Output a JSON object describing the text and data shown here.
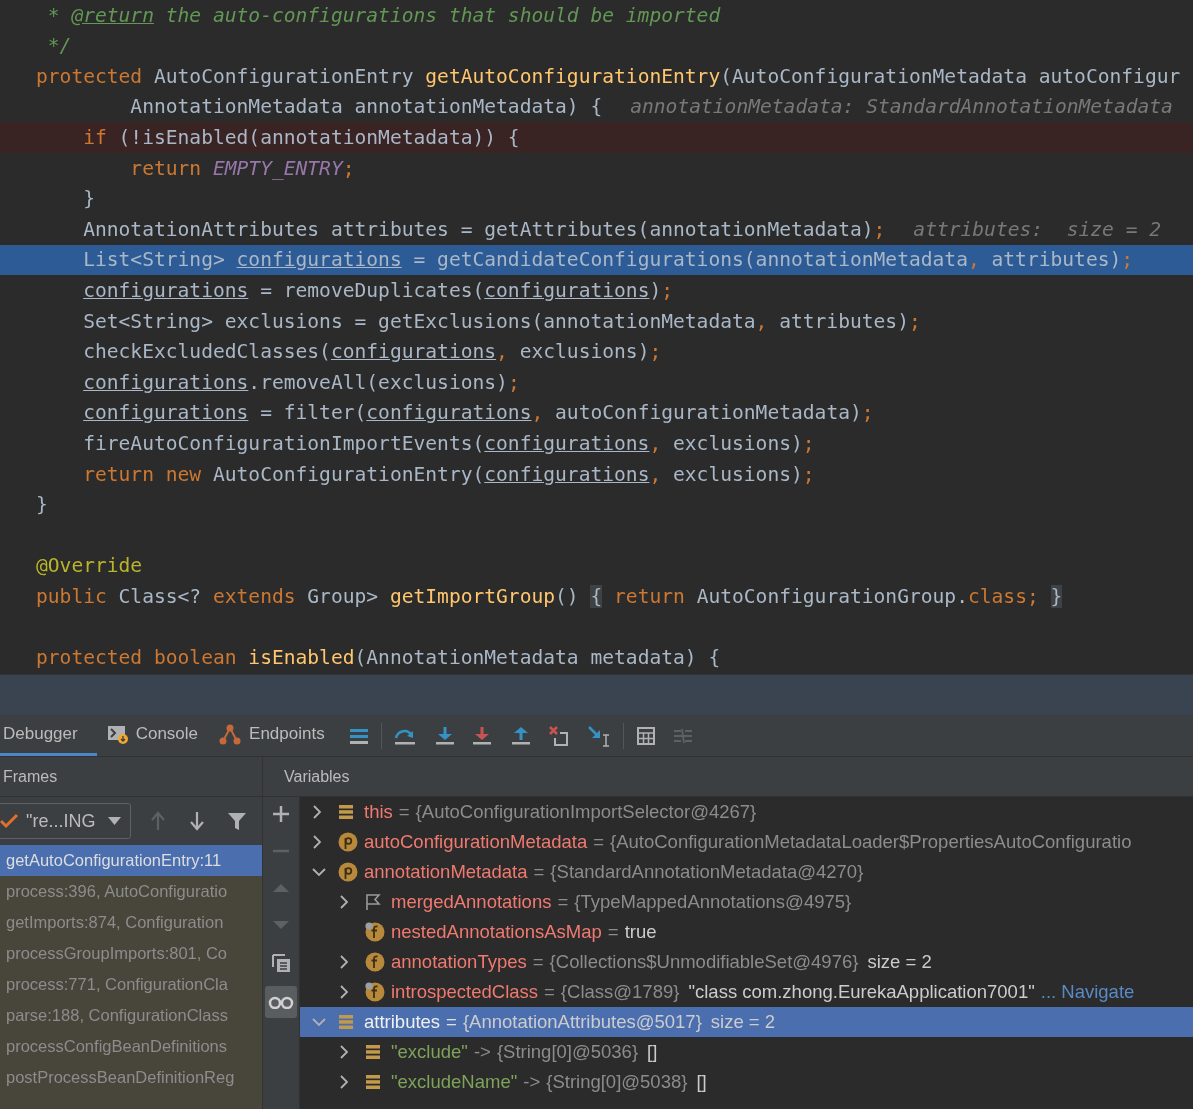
{
  "editor": {
    "lines": [
      {
        "breakpoint": false,
        "execution_point": false,
        "tokens": [
          {
            "text": " * ",
            "kind": "comment"
          },
          {
            "text": "@return",
            "kind": "doctag"
          },
          {
            "text": " the auto-configurations that should be imported",
            "kind": "comment"
          }
        ]
      },
      {
        "breakpoint": false,
        "execution_point": false,
        "tokens": [
          {
            "text": " */",
            "kind": "comment"
          }
        ]
      },
      {
        "breakpoint": false,
        "execution_point": false,
        "tokens": [
          {
            "text": "protected ",
            "kind": "keyword"
          },
          {
            "text": "AutoConfigurationEntry ",
            "kind": "plain"
          },
          {
            "text": "getAutoConfigurationEntry",
            "kind": "declaration"
          },
          {
            "text": "(AutoConfigurationMetadata autoConfigur",
            "kind": "plain"
          }
        ]
      },
      {
        "breakpoint": false,
        "execution_point": false,
        "tokens": [
          {
            "text": "        AnnotationMetadata annotationMetadata) {",
            "kind": "plain"
          }
        ],
        "hint": "annotationMetadata: StandardAnnotationMetadata"
      },
      {
        "breakpoint": true,
        "execution_point": false,
        "tokens": [
          {
            "text": "    if ",
            "kind": "keyword"
          },
          {
            "text": "(!isEnabled(annotationMetadata)) {",
            "kind": "plain"
          }
        ]
      },
      {
        "breakpoint": false,
        "execution_point": false,
        "tokens": [
          {
            "text": "        return ",
            "kind": "keyword"
          },
          {
            "text": "EMPTY_ENTRY",
            "kind": "constant"
          },
          {
            "text": ";",
            "kind": "keyword"
          }
        ]
      },
      {
        "breakpoint": false,
        "execution_point": false,
        "tokens": [
          {
            "text": "    }",
            "kind": "plain"
          }
        ]
      },
      {
        "breakpoint": false,
        "execution_point": false,
        "tokens": [
          {
            "text": "    AnnotationAttributes attributes = getAttributes(annotationMetadata)",
            "kind": "plain"
          },
          {
            "text": ";",
            "kind": "keyword"
          }
        ],
        "hint": "attributes:  size = 2"
      },
      {
        "breakpoint": false,
        "execution_point": true,
        "tokens": [
          {
            "text": "    List<String> ",
            "kind": "plain"
          },
          {
            "text": "configurations",
            "kind": "reassigned"
          },
          {
            "text": " = getCandidateConfigurations(annotationMetadata",
            "kind": "plain"
          },
          {
            "text": ",",
            "kind": "keyword"
          },
          {
            "text": " attributes)",
            "kind": "plain"
          },
          {
            "text": ";",
            "kind": "keyword"
          }
        ]
      },
      {
        "breakpoint": false,
        "execution_point": false,
        "tokens": [
          {
            "text": "    configurations",
            "kind": "reassigned"
          },
          {
            "text": " = removeDuplicates(",
            "kind": "plain"
          },
          {
            "text": "configurations",
            "kind": "reassigned"
          },
          {
            "text": ")",
            "kind": "plain"
          },
          {
            "text": ";",
            "kind": "keyword"
          }
        ]
      },
      {
        "breakpoint": false,
        "execution_point": false,
        "tokens": [
          {
            "text": "    Set<String> exclusions = getExclusions(annotationMetadata",
            "kind": "plain"
          },
          {
            "text": ",",
            "kind": "keyword"
          },
          {
            "text": " attributes)",
            "kind": "plain"
          },
          {
            "text": ";",
            "kind": "keyword"
          }
        ]
      },
      {
        "breakpoint": false,
        "execution_point": false,
        "tokens": [
          {
            "text": "    checkExcludedClasses(",
            "kind": "plain"
          },
          {
            "text": "configurations",
            "kind": "reassigned"
          },
          {
            "text": ",",
            "kind": "keyword"
          },
          {
            "text": " exclusions)",
            "kind": "plain"
          },
          {
            "text": ";",
            "kind": "keyword"
          }
        ]
      },
      {
        "breakpoint": false,
        "execution_point": false,
        "tokens": [
          {
            "text": "    configurations",
            "kind": "reassigned"
          },
          {
            "text": ".removeAll(exclusions)",
            "kind": "plain"
          },
          {
            "text": ";",
            "kind": "keyword"
          }
        ]
      },
      {
        "breakpoint": false,
        "execution_point": false,
        "tokens": [
          {
            "text": "    configurations",
            "kind": "reassigned"
          },
          {
            "text": " = filter(",
            "kind": "plain"
          },
          {
            "text": "configurations",
            "kind": "reassigned"
          },
          {
            "text": ",",
            "kind": "keyword"
          },
          {
            "text": " autoConfigurationMetadata)",
            "kind": "plain"
          },
          {
            "text": ";",
            "kind": "keyword"
          }
        ]
      },
      {
        "breakpoint": false,
        "execution_point": false,
        "tokens": [
          {
            "text": "    fireAutoConfigurationImportEvents(",
            "kind": "plain"
          },
          {
            "text": "configurations",
            "kind": "reassigned"
          },
          {
            "text": ",",
            "kind": "keyword"
          },
          {
            "text": " exclusions)",
            "kind": "plain"
          },
          {
            "text": ";",
            "kind": "keyword"
          }
        ]
      },
      {
        "breakpoint": false,
        "execution_point": false,
        "tokens": [
          {
            "text": "    return new ",
            "kind": "keyword"
          },
          {
            "text": "AutoConfigurationEntry(",
            "kind": "plain"
          },
          {
            "text": "configurations",
            "kind": "reassigned"
          },
          {
            "text": ",",
            "kind": "keyword"
          },
          {
            "text": " exclusions)",
            "kind": "plain"
          },
          {
            "text": ";",
            "kind": "keyword"
          }
        ]
      },
      {
        "breakpoint": false,
        "execution_point": false,
        "tokens": [
          {
            "text": "}",
            "kind": "plain"
          }
        ]
      },
      {
        "breakpoint": false,
        "execution_point": false
      },
      {
        "breakpoint": false,
        "execution_point": false,
        "tokens": [
          {
            "text": "@Override",
            "kind": "annotation"
          }
        ]
      },
      {
        "breakpoint": false,
        "execution_point": false,
        "tokens": [
          {
            "text": "public ",
            "kind": "keyword"
          },
          {
            "text": "Class<? ",
            "kind": "plain"
          },
          {
            "text": "extends ",
            "kind": "keyword"
          },
          {
            "text": "Group> ",
            "kind": "plain"
          },
          {
            "text": "getImportGroup",
            "kind": "declaration"
          },
          {
            "text": "() ",
            "kind": "plain"
          },
          {
            "text": "{",
            "kind": "fold"
          },
          {
            "text": " return ",
            "kind": "keyword"
          },
          {
            "text": "AutoConfigurationGroup.",
            "kind": "plain"
          },
          {
            "text": "class; ",
            "kind": "keyword"
          },
          {
            "text": "}",
            "kind": "fold"
          }
        ]
      },
      {
        "breakpoint": false,
        "execution_point": false
      },
      {
        "breakpoint": false,
        "execution_point": false,
        "tokens": [
          {
            "text": "protected boolean ",
            "kind": "keyword"
          },
          {
            "text": "isEnabled",
            "kind": "declaration"
          },
          {
            "text": "(AnnotationMetadata metadata) {",
            "kind": "plain"
          }
        ]
      }
    ]
  },
  "debugger": {
    "tabs": [
      {
        "label": "Debugger",
        "selected": true,
        "kind": "debugger"
      },
      {
        "label": "Console",
        "selected": false,
        "kind": "console"
      },
      {
        "label": "Endpoints",
        "selected": false,
        "kind": "endpoints"
      }
    ],
    "frames": {
      "title": "Frames",
      "thread": "\"re...ING",
      "items": [
        {
          "label": "getAutoConfigurationEntry:11",
          "selected": true
        },
        {
          "label": "process:396, AutoConfiguratio",
          "selected": false
        },
        {
          "label": "getImports:874, Configuration",
          "selected": false
        },
        {
          "label": "processGroupImports:801, Co",
          "selected": false
        },
        {
          "label": "process:771, ConfigurationCla",
          "selected": false
        },
        {
          "label": "parse:188, ConfigurationClass",
          "selected": false
        },
        {
          "label": "processConfigBeanDefinitions",
          "selected": false
        },
        {
          "label": "postProcessBeanDefinitionReg",
          "selected": false
        }
      ]
    },
    "variables": {
      "title": "Variables",
      "nodes": [
        {
          "name": "this",
          "kind": "object",
          "expandable": true,
          "expanded": false,
          "selected": false,
          "separator": "=",
          "value": "{AutoConfigurationImportSelector@4267}"
        },
        {
          "name": "autoConfigurationMetadata",
          "kind": "parameter",
          "expandable": true,
          "expanded": false,
          "selected": false,
          "separator": "=",
          "value": "{AutoConfigurationMetadataLoader$PropertiesAutoConfiguratio"
        },
        {
          "name": "annotationMetadata",
          "kind": "parameter",
          "expandable": true,
          "expanded": true,
          "selected": false,
          "separator": "=",
          "value": "{StandardAnnotationMetadata@4270}",
          "children": [
            {
              "name": "mergedAnnotations",
              "kind": "flag",
              "expandable": true,
              "expanded": false,
              "selected": false,
              "separator": "=",
              "value": "{TypeMappedAnnotations@4975}"
            },
            {
              "name": "nestedAnnotationsAsMap",
              "kind": "final_field",
              "expandable": false,
              "selected": false,
              "separator": "=",
              "value": "true"
            },
            {
              "name": "annotationTypes",
              "kind": "field",
              "expandable": true,
              "expanded": false,
              "selected": false,
              "separator": "=",
              "value": "{Collections$UnmodifiableSet@4976}",
              "extra": "size = 2"
            },
            {
              "name": "introspectedClass",
              "kind": "final_field",
              "expandable": true,
              "expanded": false,
              "selected": false,
              "separator": "=",
              "value": "{Class@1789}",
              "extra": "\"class com.zhong.EurekaApplication7001\"",
              "link": "... Navigate"
            }
          ]
        },
        {
          "name": "attributes",
          "kind": "object",
          "expandable": true,
          "expanded": true,
          "selected": true,
          "separator": "=",
          "value": "{AnnotationAttributes@5017}",
          "extra": "size = 2",
          "children": [
            {
              "name": "\"exclude\"",
              "kind": "map_entry",
              "expandable": true,
              "expanded": false,
              "selected": false,
              "separator": "->",
              "value": "{String[0]@5036}",
              "extra": "[]"
            },
            {
              "name": "\"excludeName\"",
              "kind": "map_entry",
              "expandable": true,
              "expanded": false,
              "selected": false,
              "separator": "->",
              "value": "{String[0]@5038}",
              "extra": "[]"
            }
          ]
        }
      ]
    }
  }
}
